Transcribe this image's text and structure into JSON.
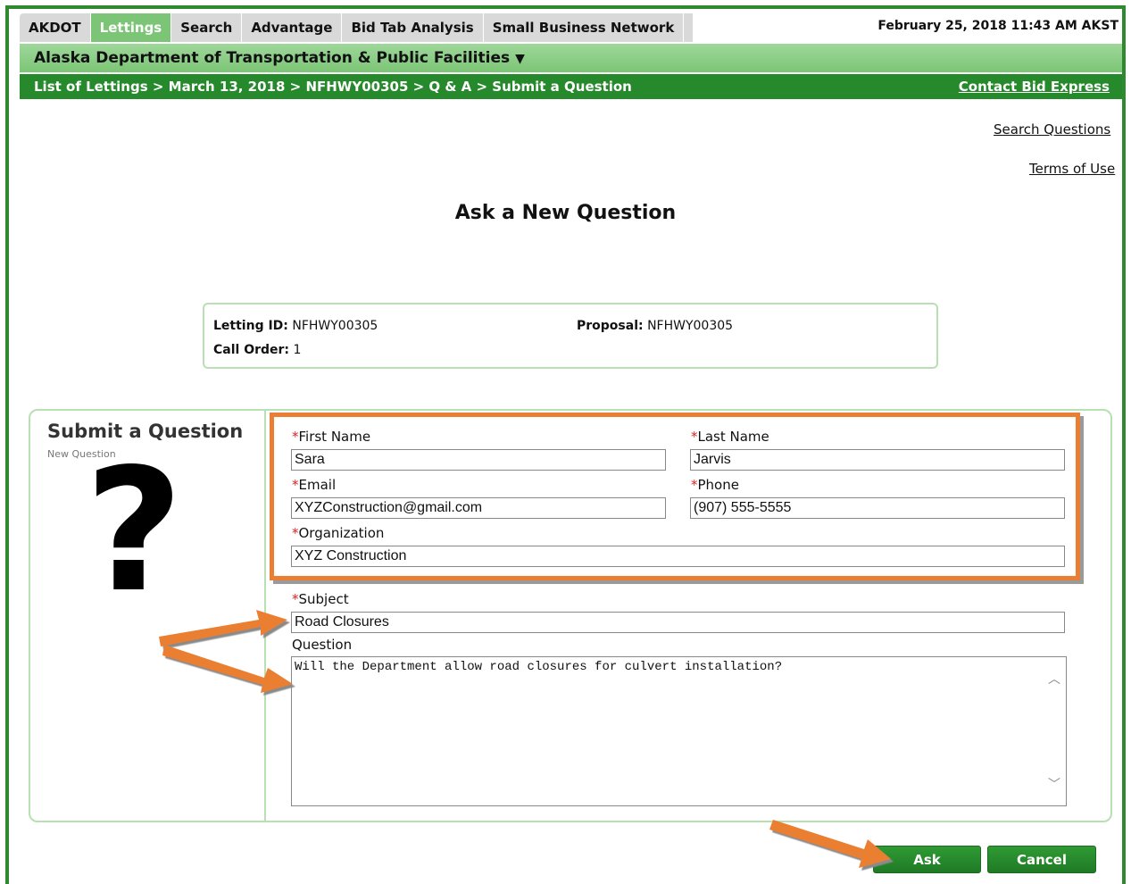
{
  "tabs": [
    {
      "label": "AKDOT",
      "active": false
    },
    {
      "label": "Lettings",
      "active": true
    },
    {
      "label": "Search",
      "active": false
    },
    {
      "label": "Advantage",
      "active": false
    },
    {
      "label": "Bid Tab Analysis",
      "active": false
    },
    {
      "label": "Small Business Network",
      "active": false
    }
  ],
  "datetime": "February 25, 2018 11:43 AM AKST",
  "agency": "Alaska Department of Transportation & Public Facilities",
  "breadcrumb": "List of Lettings > March 13, 2018 > NFHWY00305 > Q & A > Submit a Question",
  "contact_link": "Contact Bid Express",
  "links": {
    "search_questions": "Search Questions",
    "terms": "Terms of Use"
  },
  "page_title": "Ask a New Question",
  "info": {
    "letting_id_label": "Letting ID:",
    "letting_id": "NFHWY00305",
    "proposal_label": "Proposal:",
    "proposal": "NFHWY00305",
    "call_order_label": "Call Order:",
    "call_order": "1"
  },
  "panel": {
    "title": "Submit a Question",
    "subtitle": "New Question",
    "icon_glyph": "?"
  },
  "form": {
    "required_mark": "*",
    "first_name_label": "First Name",
    "first_name": "Sara",
    "last_name_label": "Last Name",
    "last_name": "Jarvis",
    "email_label": "Email",
    "email": "XYZConstruction@gmail.com",
    "phone_label": "Phone",
    "phone": "(907) 555-5555",
    "organization_label": "Organization",
    "organization": "XYZ Construction",
    "subject_label": "Subject",
    "subject": "Road Closures",
    "question_label": "Question",
    "question": "Will the Department allow road closures for culvert installation?"
  },
  "buttons": {
    "ask": "Ask",
    "cancel": "Cancel"
  },
  "colors": {
    "accent_green": "#268a2c",
    "highlight_orange": "#ea7f33",
    "active_tab": "#7cc576"
  }
}
